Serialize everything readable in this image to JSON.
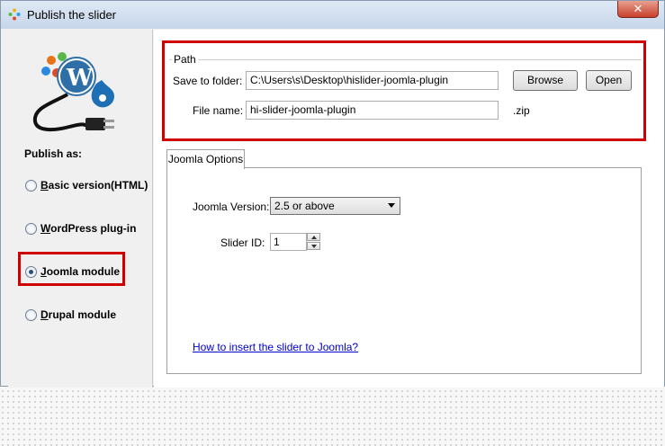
{
  "window": {
    "title": "Publish the slider",
    "close_label": "✕"
  },
  "left": {
    "publish_as_label": "Publish as:",
    "options": [
      {
        "label": "Basic version(HTML)",
        "mnemonic": "B",
        "checked": false
      },
      {
        "label": "WordPress plug-in",
        "mnemonic": "W",
        "checked": false
      },
      {
        "label": "Joomla module",
        "mnemonic": "J",
        "checked": true
      },
      {
        "label": "Drupal module",
        "mnemonic": "D",
        "checked": false
      }
    ]
  },
  "path": {
    "group_title": "Path",
    "save_label": "Save to folder:",
    "save_value": "C:\\Users\\s\\Desktop\\hislider-joomla-plugin",
    "file_label": "File name:",
    "file_value": "hi-slider-joomla-plugin",
    "ext": ".zip",
    "browse_label": "Browse",
    "open_label": "Open"
  },
  "joomla": {
    "tab_label": "Joomla Options",
    "version_label": "Joomla Version:",
    "version_value": "2.5 or above",
    "slider_id_label": "Slider ID:",
    "slider_id_value": "1",
    "help_link": "How to insert the slider to Joomla?"
  },
  "colors": {
    "highlight": "#d00000",
    "link": "#0000cc"
  }
}
